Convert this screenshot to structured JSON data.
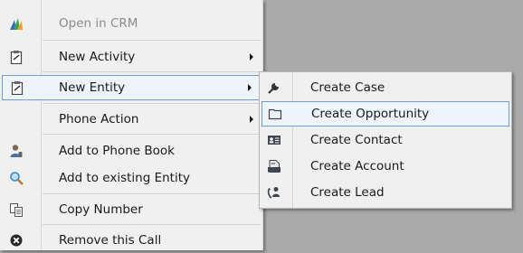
{
  "main_menu": {
    "items": [
      {
        "label": "Open in CRM",
        "icon": "crm-logo-icon",
        "enabled": false
      },
      {
        "label": "New Activity",
        "icon": "clipboard-icon",
        "submenu": true
      },
      {
        "label": "New Entity",
        "icon": "clipboard-icon",
        "submenu": true,
        "highlighted": true
      },
      {
        "label": "Phone Action",
        "submenu": true
      },
      {
        "label": "Add to Phone Book",
        "icon": "person-phone-icon"
      },
      {
        "label": "Add to existing Entity",
        "icon": "magnifier-icon"
      },
      {
        "label": "Copy Number",
        "icon": "copy-icon"
      },
      {
        "label": "Remove this Call",
        "icon": "remove-circle-icon"
      }
    ]
  },
  "sub_menu": {
    "items": [
      {
        "label": "Create Case",
        "icon": "wrench-icon"
      },
      {
        "label": "Create Opportunity",
        "icon": "folder-icon",
        "highlighted": true
      },
      {
        "label": "Create Contact",
        "icon": "contact-card-icon"
      },
      {
        "label": "Create Account",
        "icon": "account-icon"
      },
      {
        "label": "Create Lead",
        "icon": "lead-icon"
      }
    ]
  },
  "colors": {
    "menu_bg": "#f0f0f0",
    "highlight_border": "#6c9fd6",
    "highlight_bg": "#eef4fb",
    "disabled_text": "#8c8c8c",
    "background": "#aaaaaa"
  }
}
